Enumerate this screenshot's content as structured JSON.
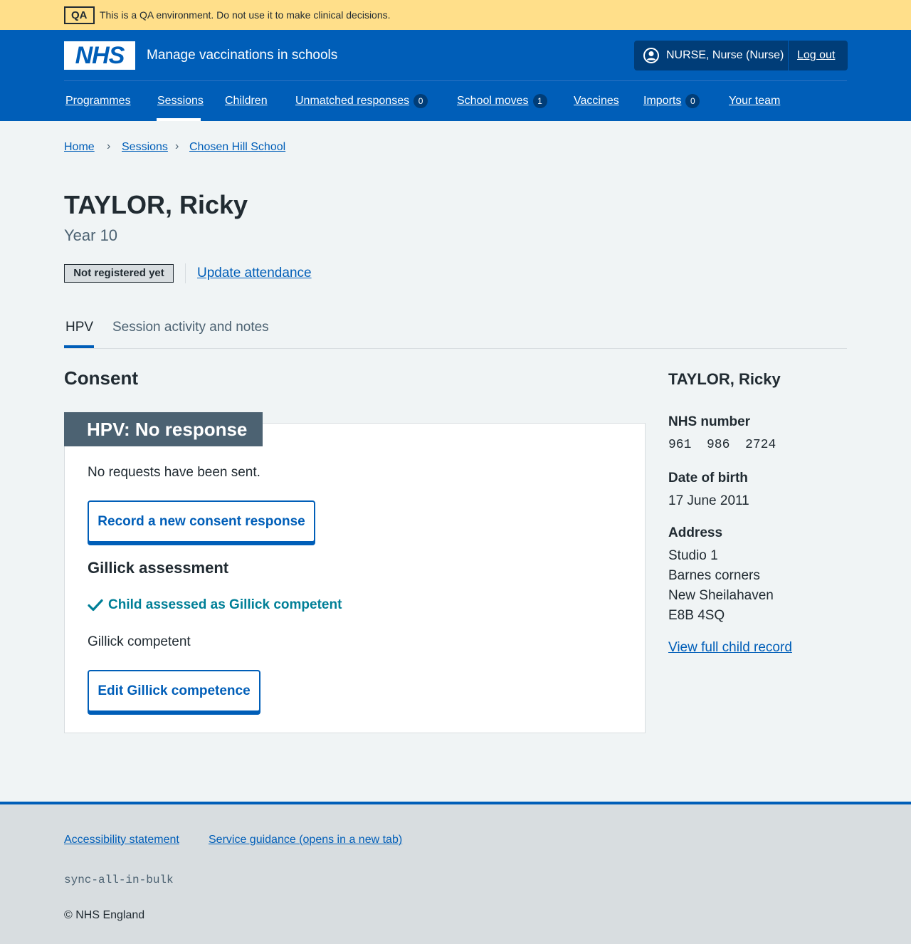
{
  "env_banner": {
    "tag": "QA",
    "text": "This is a QA environment. Do not use it to make clinical decisions."
  },
  "header": {
    "logo": "NHS",
    "service_name": "Manage vaccinations in schools",
    "account_name": "NURSE, Nurse (Nurse)",
    "logout": "Log out"
  },
  "nav": {
    "programmes": "Programmes",
    "sessions": "Sessions",
    "children": "Children",
    "unmatched": "Unmatched responses",
    "unmatched_count": "0",
    "school_moves": "School moves",
    "school_moves_count": "1",
    "vaccines": "Vaccines",
    "imports": "Imports",
    "imports_count": "0",
    "your_team": "Your team"
  },
  "breadcrumb": {
    "home": "Home",
    "sessions": "Sessions",
    "school": "Chosen Hill School",
    "separator": "›"
  },
  "patient": {
    "name": "TAYLOR, Ricky",
    "year": "Year 10",
    "registration_status": "Not registered yet",
    "update_attendance": "Update attendance"
  },
  "tabs": {
    "hpv": "HPV",
    "activity": "Session activity and notes"
  },
  "consent": {
    "heading": "Consent",
    "card_heading": "HPV: No response",
    "requests_text": "No requests have been sent.",
    "record_button": "Record a new consent response",
    "gillick_heading": "Gillick assessment",
    "gillick_status": "Child assessed as Gillick competent",
    "gillick_result": "Gillick competent",
    "edit_button": "Edit Gillick competence"
  },
  "sidebar": {
    "name": "TAYLOR, Ricky",
    "nhs_number_label": "NHS number",
    "nhs_number": "961  986  2724",
    "dob_label": "Date of birth",
    "dob": "17 June 2011",
    "address_label": "Address",
    "address_line1": "Studio 1",
    "address_line2": "Barnes corners",
    "address_line3": "New Sheilahaven",
    "address_postcode": "E8B 4SQ",
    "view_record": "View full child record"
  },
  "footer": {
    "accessibility": "Accessibility statement",
    "guidance": "Service guidance (opens in a new tab)",
    "build": "sync-all-in-bulk",
    "copyright": "© NHS England"
  },
  "colors": {
    "brand_blue": "#005eb8",
    "env_yellow": "#ffdf8a",
    "grey_bg": "#f0f4f5",
    "card_heading": "#4c6272",
    "success_teal": "#007f97"
  }
}
